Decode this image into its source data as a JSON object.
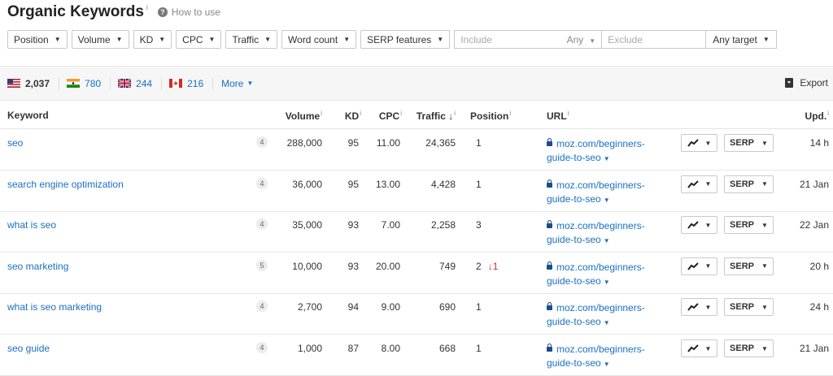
{
  "header": {
    "title": "Organic Keywords",
    "title_info": "i",
    "how_to_use": "How to use"
  },
  "filters": {
    "buttons": [
      "Position",
      "Volume",
      "KD",
      "CPC",
      "Traffic",
      "Word count",
      "SERP features"
    ],
    "include_placeholder": "Include",
    "any_label": "Any",
    "exclude_placeholder": "Exclude",
    "target_label": "Any target"
  },
  "countries": [
    {
      "flag": "us",
      "value": "2,037"
    },
    {
      "flag": "in",
      "value": "780"
    },
    {
      "flag": "gb",
      "value": "244"
    },
    {
      "flag": "ca",
      "value": "216"
    }
  ],
  "more_label": "More",
  "export_label": "Export",
  "table": {
    "headers": {
      "keyword": "Keyword",
      "volume": "Volume",
      "kd": "KD",
      "cpc": "CPC",
      "traffic": "Traffic",
      "position": "Position",
      "url": "URL",
      "upd": "Upd."
    },
    "serp_label": "SERP",
    "rows": [
      {
        "keyword": "seo",
        "badge": "4",
        "volume": "288,000",
        "kd": "95",
        "cpc": "11.00",
        "traffic": "24,365",
        "position": "1",
        "position_change": "",
        "url_line1": "moz.com/beginners-",
        "url_line2": "guide-to-seo",
        "upd": "14 h"
      },
      {
        "keyword": "search engine optimization",
        "badge": "4",
        "volume": "36,000",
        "kd": "95",
        "cpc": "13.00",
        "traffic": "4,428",
        "position": "1",
        "position_change": "",
        "url_line1": "moz.com/beginners-",
        "url_line2": "guide-to-seo",
        "upd": "21 Jan"
      },
      {
        "keyword": "what is seo",
        "badge": "4",
        "volume": "35,000",
        "kd": "93",
        "cpc": "7.00",
        "traffic": "2,258",
        "position": "3",
        "position_change": "",
        "url_line1": "moz.com/beginners-",
        "url_line2": "guide-to-seo",
        "upd": "22 Jan"
      },
      {
        "keyword": "seo marketing",
        "badge": "5",
        "volume": "10,000",
        "kd": "93",
        "cpc": "20.00",
        "traffic": "749",
        "position": "2",
        "position_change": "↓1",
        "url_line1": "moz.com/beginners-",
        "url_line2": "guide-to-seo",
        "upd": "20 h"
      },
      {
        "keyword": "what is seo marketing",
        "badge": "4",
        "volume": "2,700",
        "kd": "94",
        "cpc": "9.00",
        "traffic": "690",
        "position": "1",
        "position_change": "",
        "url_line1": "moz.com/beginners-",
        "url_line2": "guide-to-seo",
        "upd": "24 h"
      },
      {
        "keyword": "seo guide",
        "badge": "4",
        "volume": "1,000",
        "kd": "87",
        "cpc": "8.00",
        "traffic": "668",
        "position": "1",
        "position_change": "",
        "url_line1": "moz.com/beginners-",
        "url_line2": "guide-to-seo",
        "upd": "21 Jan"
      }
    ]
  },
  "colors": {
    "link": "#1a6fc2",
    "decline": "#d92525"
  }
}
